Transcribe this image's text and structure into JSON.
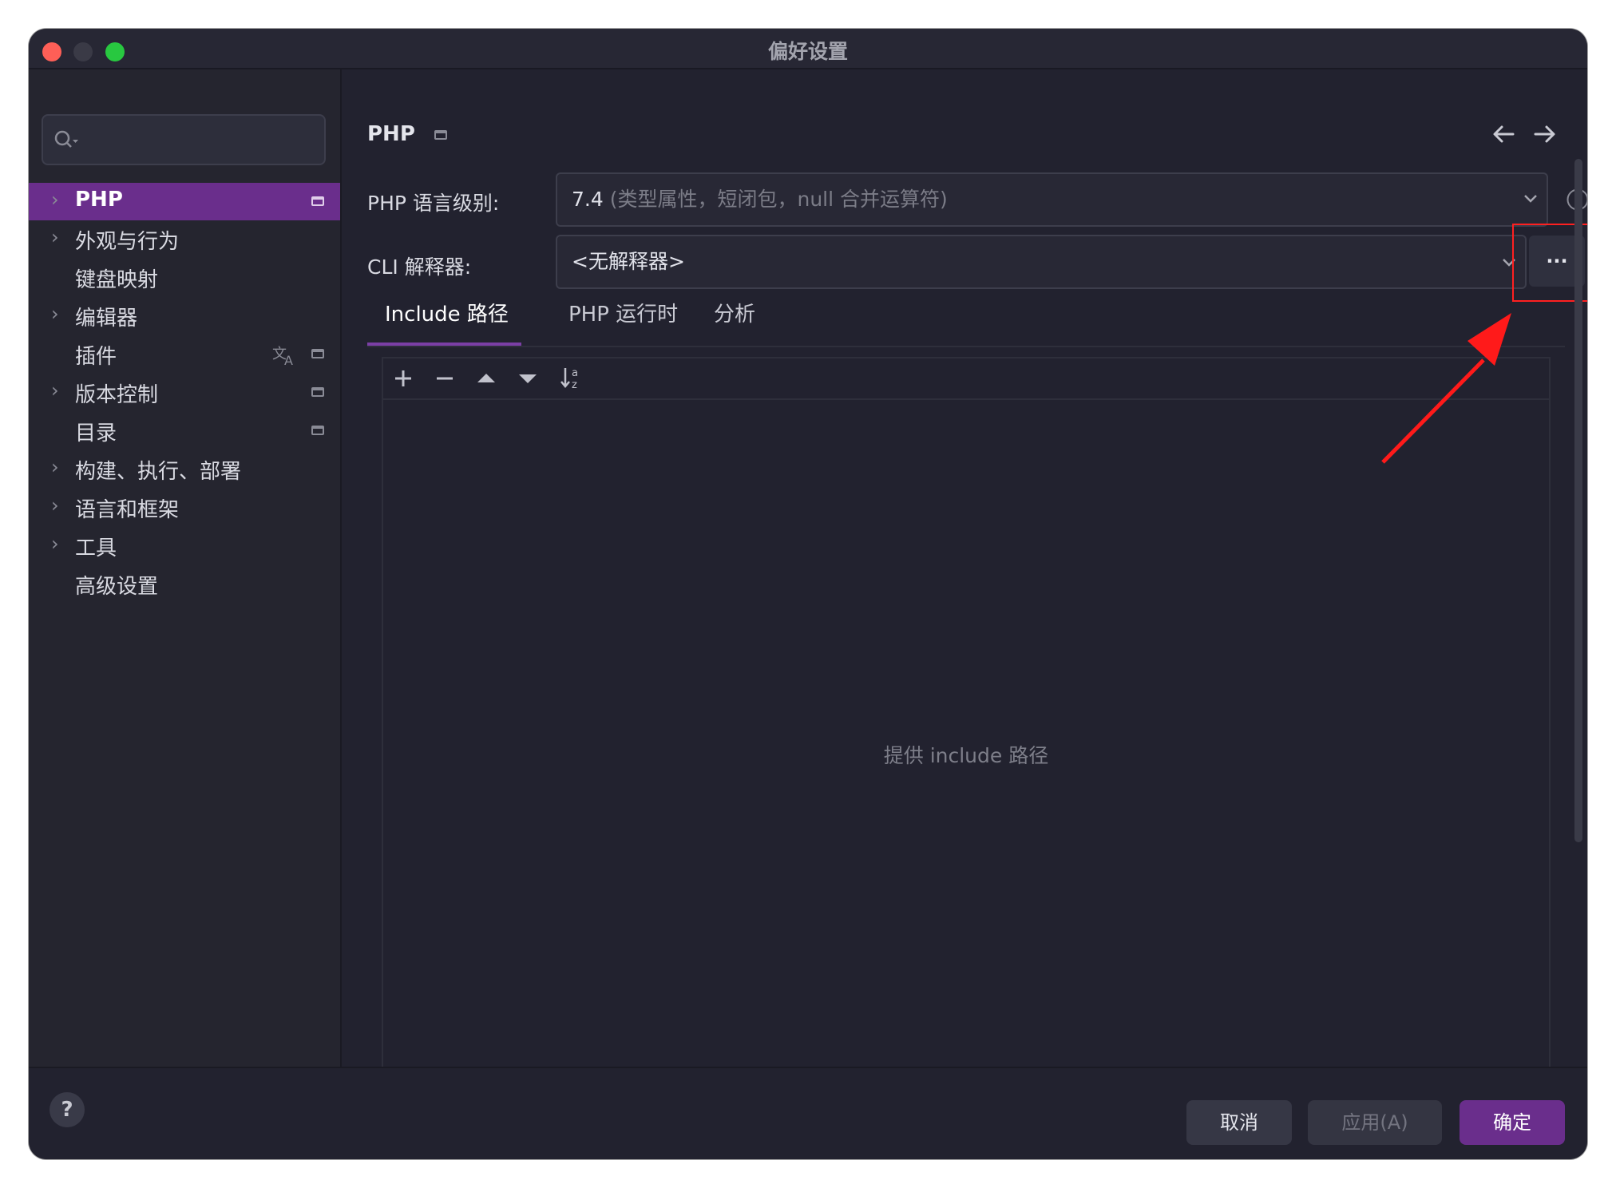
{
  "window": {
    "title": "偏好设置",
    "traffic_lights": {
      "close": "#fe5f57",
      "minimize": "#3a3a46",
      "maximize": "#28c840"
    }
  },
  "sidebar": {
    "search_placeholder": "",
    "items": [
      {
        "label": "PHP",
        "expandable": true,
        "selected": true
      },
      {
        "label": "外观与行为",
        "expandable": true
      },
      {
        "label": "键盘映射",
        "expandable": false
      },
      {
        "label": "编辑器",
        "expandable": true
      },
      {
        "label": "插件",
        "expandable": false
      },
      {
        "label": "版本控制",
        "expandable": true
      },
      {
        "label": "目录",
        "expandable": false
      },
      {
        "label": "构建、执行、部署",
        "expandable": true
      },
      {
        "label": "语言和框架",
        "expandable": true
      },
      {
        "label": "工具",
        "expandable": true
      },
      {
        "label": "高级设置",
        "expandable": false
      }
    ]
  },
  "header": {
    "title": "PHP"
  },
  "form": {
    "language_level_label": "PHP 语言级别:",
    "language_level_value": "7.4",
    "language_level_desc": "(类型属性，短闭包，null 合并运算符)",
    "cli_label": "CLI 解释器:",
    "cli_value": "<无解释器>",
    "browse_label": "..."
  },
  "tabs": [
    {
      "label": "Include 路径",
      "active": true
    },
    {
      "label": "PHP 运行时"
    },
    {
      "label": "分析"
    }
  ],
  "include_panel": {
    "empty_text": "提供 include 路径"
  },
  "footer": {
    "cancel": "取消",
    "apply": "应用(A)",
    "ok": "确定",
    "help": "?"
  },
  "colors": {
    "accent": "#6a2e8c",
    "highlight_box": "#ff2020",
    "arrow": "#ff1a1a"
  }
}
